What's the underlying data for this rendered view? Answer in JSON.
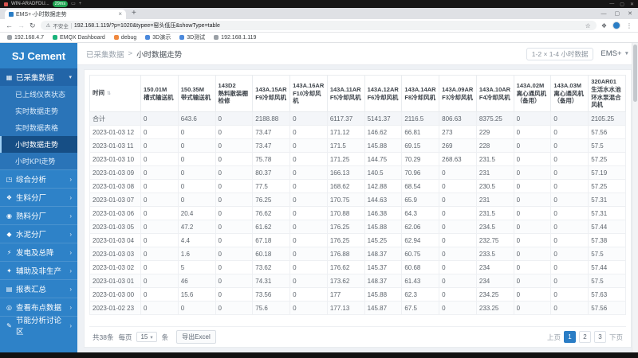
{
  "remote_bar": {
    "title": "WIN-ARADFDU...",
    "latency": "29ms"
  },
  "browser": {
    "tab_title": "EMS+·小时数据走势",
    "security_label": "不安全",
    "url": "192.168.1.119/?p=1020&typee=窑头低压&showType=table",
    "bookmarks": [
      {
        "label": "192.168.4.7",
        "color": "#9aa0a6"
      },
      {
        "label": "EMQX Dashboard",
        "color": "#19b37b"
      },
      {
        "label": "debug",
        "color": "#f0883e"
      },
      {
        "label": "3D演示",
        "color": "#4b89dc"
      },
      {
        "label": "3D测试",
        "color": "#4b89dc"
      },
      {
        "label": "192.168.1.119",
        "color": "#9aa0a6"
      }
    ]
  },
  "sidebar": {
    "logo": "SJ Cement",
    "parent_label": "已采集数据",
    "submenu": [
      {
        "label": "已上线仪表状态",
        "active": false
      },
      {
        "label": "实时数据走势",
        "active": false
      },
      {
        "label": "实时数据表格",
        "active": false
      },
      {
        "label": "小时数据走势",
        "active": true
      },
      {
        "label": "小时KPI走势",
        "active": false
      }
    ],
    "sections": [
      {
        "label": "综合分析",
        "icon": "analysis-icon",
        "chevron": true
      },
      {
        "label": "生料分厂",
        "icon": "raw-material-icon",
        "chevron": true
      },
      {
        "label": "熟料分厂",
        "icon": "clinker-icon",
        "chevron": true
      },
      {
        "label": "水泥分厂",
        "icon": "cement-icon",
        "chevron": true
      },
      {
        "label": "发电及总降",
        "icon": "power-icon",
        "chevron": true
      },
      {
        "label": "辅助及非生产",
        "icon": "auxiliary-icon",
        "chevron": true
      },
      {
        "label": "报表汇总",
        "icon": "report-icon",
        "chevron": true
      },
      {
        "label": "查看布点数据",
        "icon": "points-icon",
        "chevron": true
      },
      {
        "label": "节能分析讨论区",
        "icon": "forum-icon",
        "chevron": true
      }
    ]
  },
  "topbar": {
    "breadcrumb_parent": "已采集数据",
    "breadcrumb_sep": ">",
    "breadcrumb_current": "小时数据走势",
    "range_chip": "1-2 × 1-4 小时数据",
    "app_menu": "EMS+"
  },
  "table": {
    "columns": [
      {
        "code": "时间",
        "name": ""
      },
      {
        "code": "150.01M",
        "name": "槽式输送机"
      },
      {
        "code": "150.35M",
        "name": "带式输送机"
      },
      {
        "code": "143D2",
        "name": "熟料散装棚检修"
      },
      {
        "code": "143A.15AR",
        "name": "F9冷却风机"
      },
      {
        "code": "143A.16AR",
        "name": "F10冷却风机"
      },
      {
        "code": "143A.11AR",
        "name": "F5冷却风机"
      },
      {
        "code": "143A.12AR",
        "name": "F6冷却风机"
      },
      {
        "code": "143A.14AR",
        "name": "F8冷却风机"
      },
      {
        "code": "143A.09AR",
        "name": "F3冷却风机"
      },
      {
        "code": "143A.10AR",
        "name": "F4冷却风机"
      },
      {
        "code": "143A.02M",
        "name": "离心通风机（备用）"
      },
      {
        "code": "143A.03M",
        "name": "离心通风机（备用）"
      },
      {
        "code": "320AR01",
        "name": "生活水水池环水泵混合风机"
      }
    ],
    "rows": [
      [
        "合计",
        "0",
        "643.6",
        "0",
        "2188.88",
        "0",
        "6117.37",
        "5141.37",
        "2116.5",
        "806.63",
        "8375.25",
        "0",
        "0",
        "2105.25"
      ],
      [
        "2023-01-03 12",
        "0",
        "0",
        "0",
        "73.47",
        "0",
        "171.12",
        "146.62",
        "66.81",
        "273",
        "229",
        "0",
        "0",
        "57.56"
      ],
      [
        "2023-01-03 11",
        "0",
        "0",
        "0",
        "73.47",
        "0",
        "171.5",
        "145.88",
        "69.15",
        "269",
        "228",
        "0",
        "0",
        "57.5"
      ],
      [
        "2023-01-03 10",
        "0",
        "0",
        "0",
        "75.78",
        "0",
        "171.25",
        "144.75",
        "70.29",
        "268.63",
        "231.5",
        "0",
        "0",
        "57.25"
      ],
      [
        "2023-01-03 09",
        "0",
        "0",
        "0",
        "80.37",
        "0",
        "166.13",
        "140.5",
        "70.96",
        "0",
        "231",
        "0",
        "0",
        "57.19"
      ],
      [
        "2023-01-03 08",
        "0",
        "0",
        "0",
        "77.5",
        "0",
        "168.62",
        "142.88",
        "68.54",
        "0",
        "230.5",
        "0",
        "0",
        "57.25"
      ],
      [
        "2023-01-03 07",
        "0",
        "0",
        "0",
        "76.25",
        "0",
        "170.75",
        "144.63",
        "65.9",
        "0",
        "231",
        "0",
        "0",
        "57.31"
      ],
      [
        "2023-01-03 06",
        "0",
        "20.4",
        "0",
        "76.62",
        "0",
        "170.88",
        "146.38",
        "64.3",
        "0",
        "231.5",
        "0",
        "0",
        "57.31"
      ],
      [
        "2023-01-03 05",
        "0",
        "47.2",
        "0",
        "61.62",
        "0",
        "176.25",
        "145.88",
        "62.06",
        "0",
        "234.5",
        "0",
        "0",
        "57.44"
      ],
      [
        "2023-01-03 04",
        "0",
        "4.4",
        "0",
        "67.18",
        "0",
        "176.25",
        "145.25",
        "62.94",
        "0",
        "232.75",
        "0",
        "0",
        "57.38"
      ],
      [
        "2023-01-03 03",
        "0",
        "1.6",
        "0",
        "60.18",
        "0",
        "176.88",
        "148.37",
        "60.75",
        "0",
        "233.5",
        "0",
        "0",
        "57.5"
      ],
      [
        "2023-01-03 02",
        "0",
        "5",
        "0",
        "73.62",
        "0",
        "176.62",
        "145.37",
        "60.68",
        "0",
        "234",
        "0",
        "0",
        "57.44"
      ],
      [
        "2023-01-03 01",
        "0",
        "46",
        "0",
        "74.31",
        "0",
        "173.62",
        "148.37",
        "61.43",
        "0",
        "234",
        "0",
        "0",
        "57.5"
      ],
      [
        "2023-01-03 00",
        "0",
        "15.6",
        "0",
        "73.56",
        "0",
        "177",
        "145.88",
        "62.3",
        "0",
        "234.25",
        "0",
        "0",
        "57.63"
      ],
      [
        "2023-01-02 23",
        "0",
        "0",
        "0",
        "75.6",
        "0",
        "177.13",
        "145.87",
        "67.5",
        "0",
        "233.25",
        "0",
        "0",
        "57.56"
      ]
    ]
  },
  "footer": {
    "total_text": "共38条",
    "per_page_prefix": "每页",
    "per_page_value": "15",
    "per_page_suffix": "条",
    "export_label": "导出Excel",
    "pagination": {
      "prev_label": "上页",
      "pages": [
        "1",
        "2",
        "3"
      ],
      "active": "1",
      "next_label": "下页"
    }
  },
  "colors": {
    "accent": "#2a7dc5",
    "sidebar": "#2e82c8",
    "latency_green": "#21a453"
  }
}
